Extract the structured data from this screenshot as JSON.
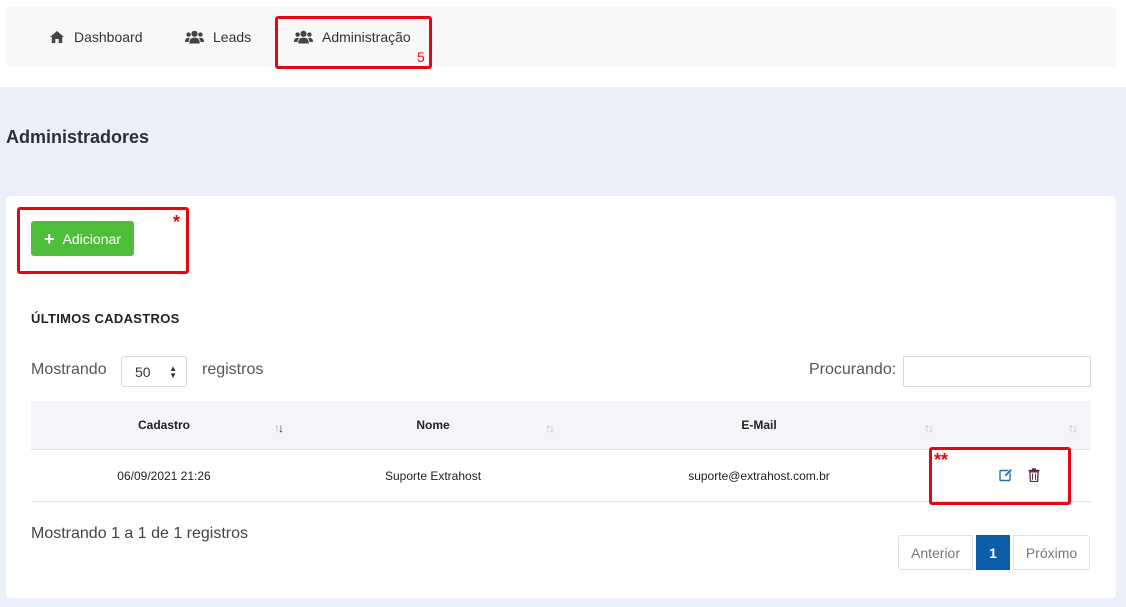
{
  "nav": {
    "items": [
      {
        "label": "Dashboard",
        "icon": "home-icon"
      },
      {
        "label": "Leads",
        "icon": "users-icon"
      },
      {
        "label": "Administração",
        "icon": "users-icon"
      }
    ]
  },
  "annotations": {
    "nav_marker": "5",
    "add_marker": "*",
    "actions_marker": "**",
    "color": "#e30613"
  },
  "page": {
    "title": "Administradores"
  },
  "toolbar": {
    "add_label": "Adicionar",
    "add_color": "#4ebd3a"
  },
  "section": {
    "title": "ÚLTIMOS CADASTROS"
  },
  "length": {
    "prefix": "Mostrando",
    "value": "50",
    "suffix": "registros"
  },
  "search": {
    "label": "Procurando:",
    "value": ""
  },
  "table": {
    "columns": [
      "Cadastro",
      "Nome",
      "E-Mail",
      ""
    ],
    "rows": [
      {
        "cadastro": "06/09/2021 21:26",
        "nome": "Suporte Extrahost",
        "email": "suporte@extrahost.com.br",
        "actions": [
          "edit-icon",
          "trash-icon"
        ]
      }
    ]
  },
  "info": "Mostrando 1 a 1 de 1 registros",
  "pagination": {
    "previous": "Anterior",
    "current": "1",
    "next": "Próximo",
    "active_color": "#0d5eaa"
  }
}
